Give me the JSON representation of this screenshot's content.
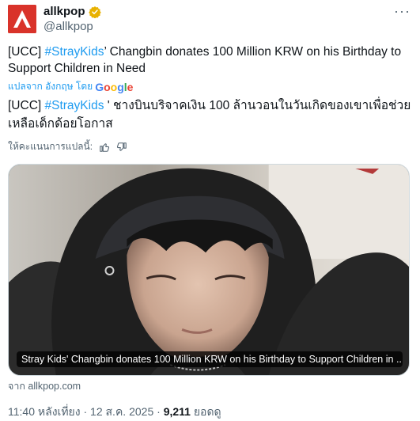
{
  "author": {
    "display_name": "allkpop",
    "handle": "@allkpop",
    "verified": true,
    "avatar_color": "#d9332a",
    "verified_color": "#e8b100"
  },
  "tweet": {
    "prefix": "[UCC] ",
    "hashtag": "#StrayKids",
    "text_rest": "’ Changbin donates 100 Million KRW on his Birthday to Support Children in Need"
  },
  "translation": {
    "label": "แปลจาก อังกฤษ โดย",
    "provider": "Google",
    "prefix": "[UCC] ",
    "hashtag": "#StrayKids",
    "text_rest": " ' ชางบินบริจาคเงิน 100 ล้านวอนในวันเกิดของเขาเพื่อช่วยเหลือเด็กด้อยโอกาส",
    "rate_label": "ให้คะแนนการแปลนี้:"
  },
  "card": {
    "caption": "Stray Kids' Changbin donates 100 Million KRW on his Birthday to Support Children in ...",
    "source": "จาก allkpop.com"
  },
  "meta": {
    "time": "11:40 หลังเที่ยง",
    "separator": " · ",
    "date": "12 ส.ค. 2025",
    "views_count": "9,211",
    "views_label": " ยอดดู"
  },
  "icons": {
    "more": "more-icon",
    "thumbs_up": "thumbs-up-icon",
    "thumbs_down": "thumbs-down-icon",
    "verified": "verified-badge-icon"
  },
  "colors": {
    "accent": "#1d9bf0",
    "text": "#0f1419",
    "secondary": "#536471"
  }
}
